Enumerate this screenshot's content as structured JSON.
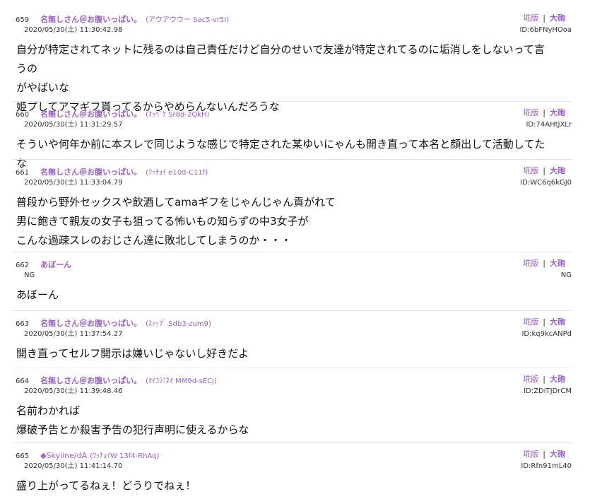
{
  "actions": {
    "ita_label": "埖版",
    "taiho_label": "大砲",
    "separator": "|"
  },
  "posts": [
    {
      "num": "659",
      "name": "名無しさん＠お腹いっぱい。",
      "trip": "(アウアウウー Sac5-vr5I)",
      "date": "2020/05/30(土) 11:30:42.98",
      "uid": "ID:6bFNyHOoa",
      "lines": [
        "自分が特定されてネットに残るのは自己責任だけど自分のせいで友達が特定されてるのに垢消しをしないって言うの",
        "がやばいな",
        "姫プしてアマギフ貰ってるからやめらんないんだろうな"
      ]
    },
    {
      "num": "660",
      "name": "名無しさん＠お腹いっぱい。",
      "trip": "(ｵｯﾍﾟｹ Sr8d-2QkH)",
      "date": "2020/05/30(土) 11:31:29.57",
      "uid": "ID:74AHtJXLr",
      "lines": [
        "そういや何年か前に本スレで同じような感じで特定された某ゆいにゃんも開き直って本名と顔出して活動してたな"
      ]
    },
    {
      "num": "661",
      "name": "名無しさん＠お腹いっぱい。",
      "trip": "(ﾜｯﾁｮｲ e10d-C11f)",
      "date": "2020/05/30(土) 11:33:04.79",
      "uid": "ID:WC6q6kGJ0",
      "lines": [
        "普段から野外セックスや飲酒してamaギフをじゃんじゃん貢がれて",
        "男に飽きて親友の女子も狙ってる怖いもの知らずの中3女子が",
        "こんな過疎スレのおじさん達に敗北してしまうのか・・・"
      ]
    },
    {
      "num": "662",
      "name": "あぼーん",
      "trip": "",
      "date": "NG",
      "uid": "NG",
      "lines": [
        "あぼーん"
      ]
    },
    {
      "num": "663",
      "name": "名無しさん＠お腹いっぱい。",
      "trip": "(ｽｯｯﾌﾟ Sdb3-zum9)",
      "date": "2020/05/30(土) 11:37:54.27",
      "uid": "ID:kq9kcANPd",
      "lines": [
        "開き直ってセルフ開示は嫌いじゃないし好きだよ"
      ]
    },
    {
      "num": "664",
      "name": "名無しさん＠お腹いっぱい。",
      "trip": "(ｵｲｺﾗﾐﾈｵ MM9d-sECj)",
      "date": "2020/05/30(土) 11:39:48.46",
      "uid": "ID:ZDiTJDrCM",
      "lines": [
        "名前わかれば",
        "爆破予告とか殺害予告の犯行声明に使えるからな"
      ]
    },
    {
      "num": "665",
      "name": "◆Skyline/dA",
      "trip": "(ﾜｯﾁｮｲW 13f4-RhAq)",
      "date": "2020/05/30(土) 11:41:14.70",
      "uid": "ID:Rfn91mL40",
      "lines": [
        "盛り上がってるねぇ！どうりでねぇ！"
      ]
    }
  ]
}
